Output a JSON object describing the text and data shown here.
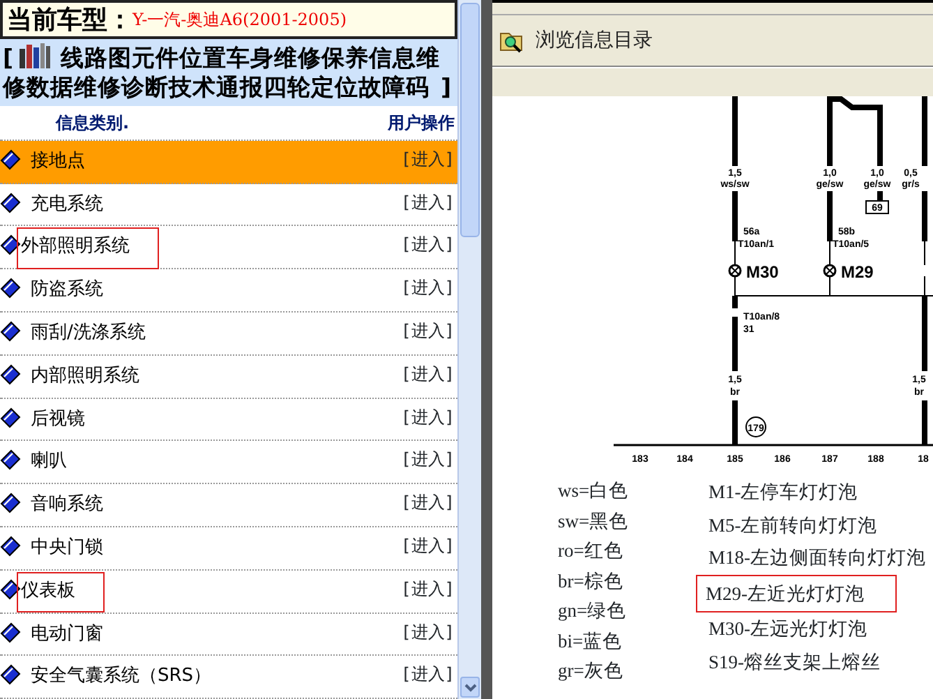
{
  "current_model": {
    "label": "当前车型：",
    "value": "Y-一汽-奥迪A6(2001-2005)"
  },
  "title": {
    "open": "[",
    "lines": [
      "线路图元件位置车身维修保养信息维",
      "修数据维修诊断技术通报四轮定位故障码"
    ],
    "close": "]"
  },
  "columns": [
    "信息类别.",
    "用户操作"
  ],
  "rows": [
    {
      "label": "接地点",
      "action": "[进入]",
      "selected": true,
      "highlighted": false
    },
    {
      "label": "充电系统",
      "action": "[进入]",
      "selected": false,
      "highlighted": false
    },
    {
      "label": "外部照明系统",
      "action": "[进入]",
      "selected": false,
      "highlighted": true
    },
    {
      "label": "防盗系统",
      "action": "[进入]",
      "selected": false,
      "highlighted": false
    },
    {
      "label": "雨刮/洗涤系统",
      "action": "[进入]",
      "selected": false,
      "highlighted": false
    },
    {
      "label": "内部照明系统",
      "action": "[进入]",
      "selected": false,
      "highlighted": false
    },
    {
      "label": "后视镜",
      "action": "[进入]",
      "selected": false,
      "highlighted": false
    },
    {
      "label": "喇叭",
      "action": "[进入]",
      "selected": false,
      "highlighted": false
    },
    {
      "label": "音响系统",
      "action": "[进入]",
      "selected": false,
      "highlighted": false
    },
    {
      "label": "中央门锁",
      "action": "[进入]",
      "selected": false,
      "highlighted": false
    },
    {
      "label": "仪表板",
      "action": "[进入]",
      "selected": false,
      "highlighted": true
    },
    {
      "label": "电动门窗",
      "action": "[进入]",
      "selected": false,
      "highlighted": false
    },
    {
      "label": "安全气囊系统（SRS）",
      "action": "[进入]",
      "selected": false,
      "highlighted": false
    }
  ],
  "viewer": {
    "toolbar_title": "浏览信息目录",
    "diagram": {
      "wires": [
        {
          "size": "1,5",
          "color_code": "ws/sw",
          "pin": "56a",
          "connector": "T10an/1",
          "component": "M30"
        },
        {
          "size": "1,0",
          "color_code": "ge/sw",
          "pin": "58b",
          "connector": "T10an/5",
          "component": "M29"
        },
        {
          "size": "1,0",
          "color_code": "ge/sw",
          "fuse": "69"
        },
        {
          "size": "0,5",
          "color_code": "gr/s"
        }
      ],
      "ground_connector": "T10an/8",
      "ground_pin": "31",
      "ground_wires": [
        {
          "size": "1,5",
          "color_code": "br"
        },
        {
          "size": "1,5",
          "color_code": "br"
        }
      ],
      "ground_point": "179",
      "positions": [
        "183",
        "184",
        "185",
        "186",
        "187",
        "188",
        "18"
      ]
    },
    "color_legend": [
      "ws=白色",
      "sw=黑色",
      "ro=红色",
      "br=棕色",
      "gn=绿色",
      "bi=蓝色",
      "gr=灰色"
    ],
    "component_legend": [
      {
        "text": "M1-左停车灯灯泡",
        "highlighted": false
      },
      {
        "text": "M5-左前转向灯灯泡",
        "highlighted": false
      },
      {
        "text": "M18-左边侧面转向灯灯泡",
        "highlighted": false
      },
      {
        "text": "M29-左近光灯灯泡",
        "highlighted": true
      },
      {
        "text": "M30-左远光灯灯泡",
        "highlighted": false
      },
      {
        "text": "S19-熔丝支架上熔丝",
        "highlighted": false
      }
    ]
  }
}
